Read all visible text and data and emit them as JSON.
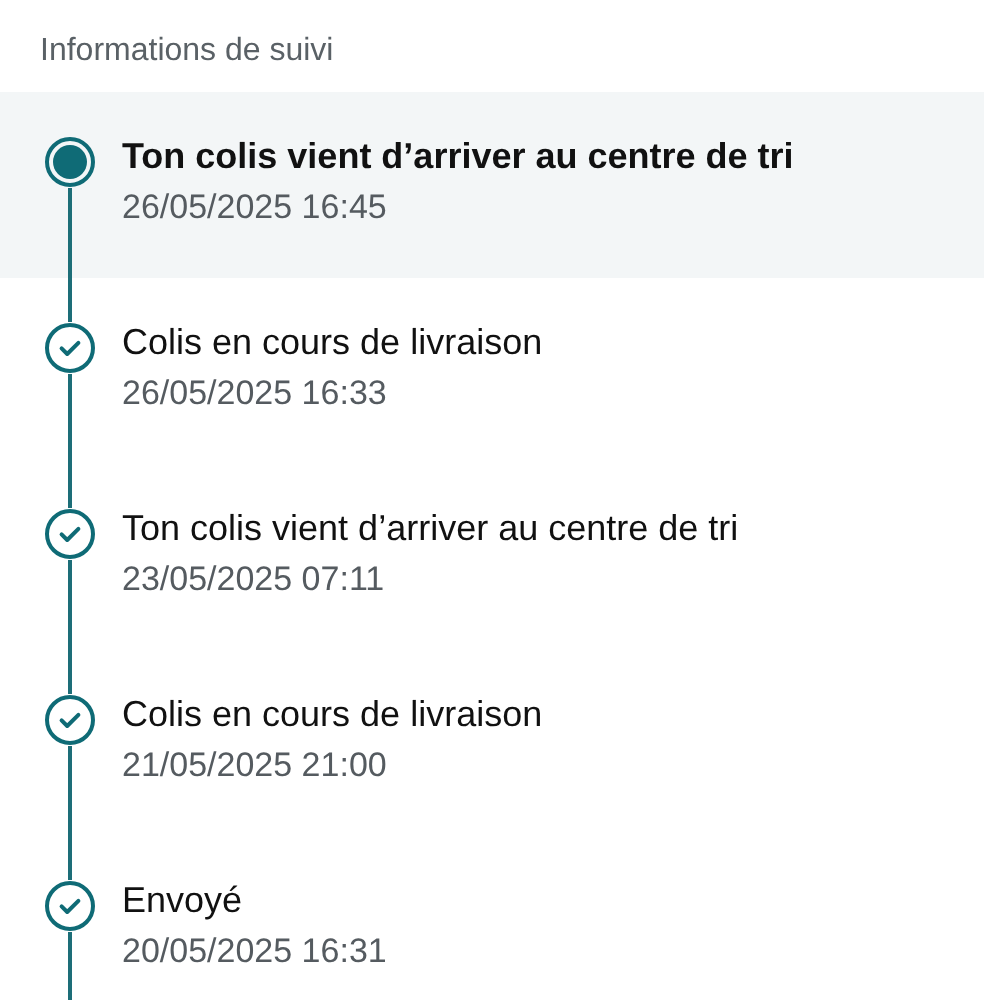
{
  "heading": "Informations de suivi",
  "events": [
    {
      "title": "Ton colis vient d’arriver au centre de tri",
      "date": "26/05/2025 16:45",
      "selected": true
    },
    {
      "title": "Colis en cours de livraison",
      "date": "26/05/2025 16:33",
      "selected": false
    },
    {
      "title": "Ton colis vient d’arriver au centre de tri",
      "date": "23/05/2025 07:11",
      "selected": false
    },
    {
      "title": "Colis en cours de livraison",
      "date": "21/05/2025 21:00",
      "selected": false
    },
    {
      "title": "Envoyé",
      "date": "20/05/2025 16:31",
      "selected": false
    }
  ]
}
